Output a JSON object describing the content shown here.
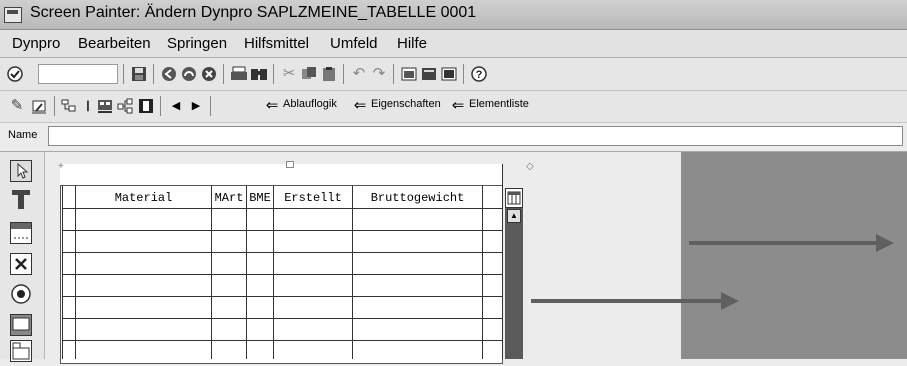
{
  "window": {
    "title": "Screen Painter: Ändern Dynpro SAPLZMEINE_TABELLE 0001"
  },
  "menu": [
    "Dynpro",
    "Bearbeiten",
    "Springen",
    "Hilfsmittel",
    "Umfeld",
    "Hilfe"
  ],
  "toolbar2": {
    "ablauflogik": "Ablauflogik",
    "eigenschaften": "Eigenschaften",
    "elementliste": "Elementliste"
  },
  "name_row": {
    "label": "Name",
    "value": ""
  },
  "table": {
    "columns": [
      "Material",
      "MArt",
      "BME",
      "Erstellt",
      "Bruttogewicht"
    ]
  }
}
